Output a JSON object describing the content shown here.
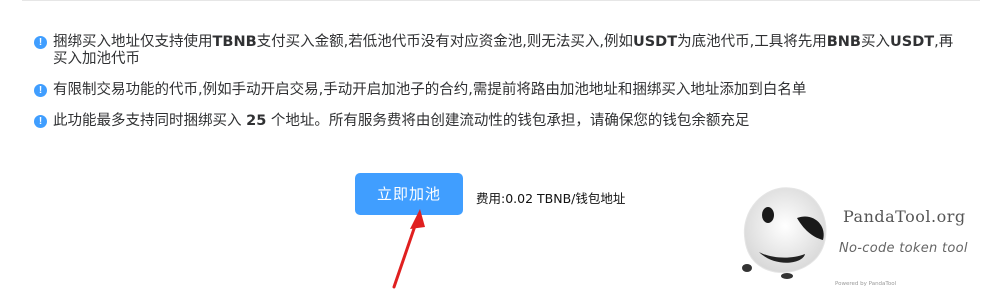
{
  "notes": [
    {
      "segments": [
        {
          "text": "捆绑买入地址仅支持使用",
          "bold": false
        },
        {
          "text": "TBNB",
          "bold": true
        },
        {
          "text": "支付买入金额,若低池代币没有对应资金池,则无法买入,例如",
          "bold": false
        },
        {
          "text": "USDT",
          "bold": true
        },
        {
          "text": "为底池代币,工具将先用",
          "bold": false
        },
        {
          "text": "BNB",
          "bold": true
        },
        {
          "text": "买入",
          "bold": false
        },
        {
          "text": "USDT",
          "bold": true
        },
        {
          "text": ",再买入加池代币",
          "bold": false
        }
      ]
    },
    {
      "segments": [
        {
          "text": "有限制交易功能的代币,例如手动开启交易,手动开启加池子的合约,需提前将路由加池地址和捆绑买入地址添加到白名单",
          "bold": false
        }
      ]
    },
    {
      "segments": [
        {
          "text": "此功能最多支持同时捆绑买入 ",
          "bold": false
        },
        {
          "text": "25",
          "bold": true
        },
        {
          "text": " 个地址。所有服务费将由创建流动性的钱包承担，请确保您的钱包余额充足",
          "bold": false
        }
      ]
    }
  ],
  "info_icon_glyph": "!",
  "action": {
    "button_label": "立即加池",
    "fee_text": "费用:0.02 TBNB/钱包地址"
  },
  "brand": {
    "name": "PandaTool.org",
    "tagline": "No-code token tool",
    "powered": "Powered by PandaTool"
  },
  "colors": {
    "primary": "#409eff",
    "arrow": "#e02020"
  }
}
